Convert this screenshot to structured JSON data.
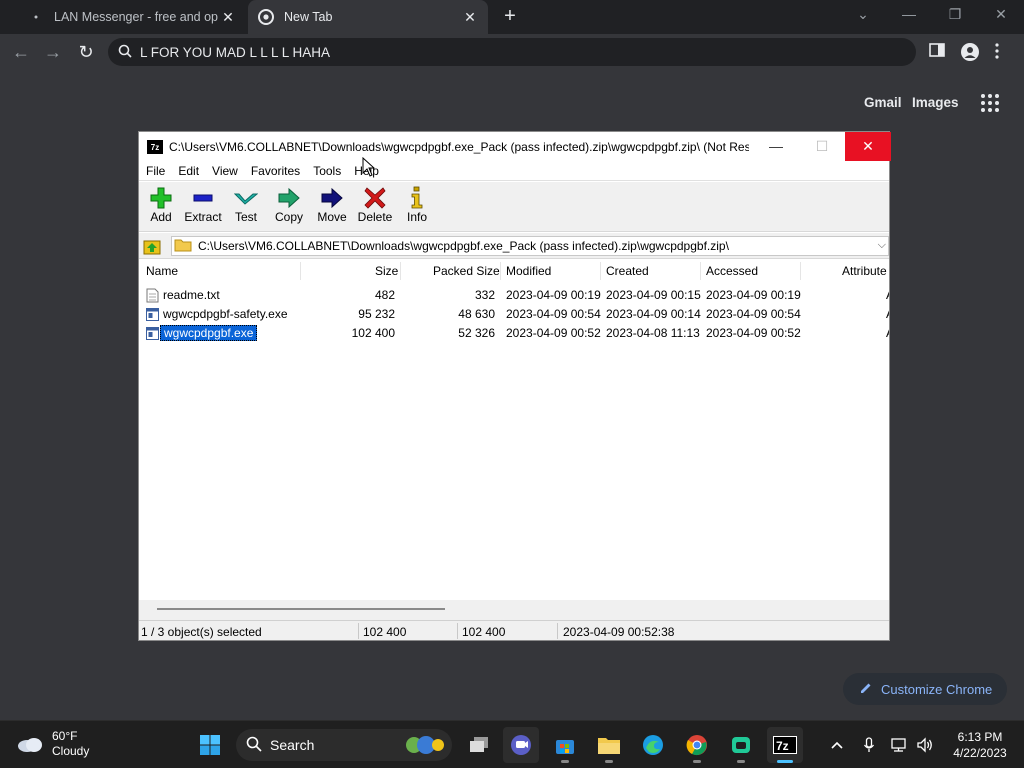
{
  "browser": {
    "tabs": [
      {
        "title": "LAN Messenger - free and open"
      },
      {
        "title": "New Tab"
      }
    ],
    "omnibox_value": "L FOR YOU MAD L L L L HAHA",
    "newtab_links": {
      "gmail": "Gmail",
      "images": "Images"
    },
    "customize_label": "Customize Chrome"
  },
  "zip_window": {
    "title": "C:\\Users\\VM6.COLLABNET\\Downloads\\wgwcpdpgbf.exe_Pack (pass infected).zip\\wgwcpdpgbf.zip\\ (Not Res...",
    "menu": [
      "File",
      "Edit",
      "View",
      "Favorites",
      "Tools",
      "Help"
    ],
    "toolbar": {
      "add": "Add",
      "extract": "Extract",
      "test": "Test",
      "copy": "Copy",
      "move": "Move",
      "delete": "Delete",
      "info": "Info"
    },
    "path": "C:\\Users\\VM6.COLLABNET\\Downloads\\wgwcpdpgbf.exe_Pack (pass infected).zip\\wgwcpdpgbf.zip\\",
    "columns": {
      "name": "Name",
      "size": "Size",
      "packed": "Packed Size",
      "modified": "Modified",
      "created": "Created",
      "accessed": "Accessed",
      "attributes": "Attribute"
    },
    "rows": [
      {
        "name": "readme.txt",
        "size": "482",
        "packed": "332",
        "modified": "2023-04-09 00:19",
        "created": "2023-04-09 00:15",
        "accessed": "2023-04-09 00:19",
        "attr": "A"
      },
      {
        "name": "wgwcpdpgbf-safety.exe",
        "size": "95 232",
        "packed": "48 630",
        "modified": "2023-04-09 00:54",
        "created": "2023-04-09 00:14",
        "accessed": "2023-04-09 00:54",
        "attr": "A"
      },
      {
        "name": "wgwcpdpgbf.exe",
        "size": "102 400",
        "packed": "52 326",
        "modified": "2023-04-09 00:52",
        "created": "2023-04-08 11:13",
        "accessed": "2023-04-09 00:52",
        "attr": "A"
      }
    ],
    "status": {
      "selection": "1 / 3 object(s) selected",
      "size": "102 400",
      "packed": "102 400",
      "date": "2023-04-09 00:52:38"
    }
  },
  "taskbar": {
    "weather_temp": "60°F",
    "weather_desc": "Cloudy",
    "search_label": "Search",
    "time": "6:13 PM",
    "date": "4/22/2023"
  },
  "colors": {
    "chrome_bg": "#35363a",
    "tabstrip": "#202124",
    "close_red": "#e81123",
    "selection_blue": "#0a64d8",
    "accent_blue": "#8ab4f8"
  }
}
